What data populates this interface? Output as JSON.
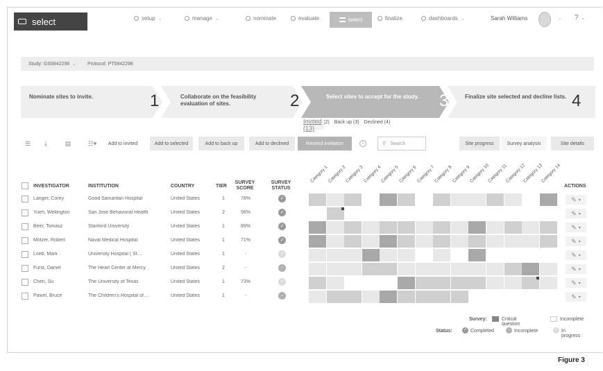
{
  "app": {
    "logo_label": "select"
  },
  "nav": {
    "setup": "setup",
    "manage": "manage",
    "nominate": "nominate",
    "evaluate": "evaluate",
    "select": "select",
    "finalize": "finalize",
    "dashboards": "dashboards",
    "user": "Sarah Williams",
    "help": "?"
  },
  "studybar": {
    "study": "Study: GS5842298",
    "protocol": "Protocol: PT5842298"
  },
  "steps": [
    {
      "text": "Nominate sites to invite.",
      "num": "1"
    },
    {
      "text": "Collaborate on the feasibility evaluation of sites.",
      "num": "2"
    },
    {
      "text": "Select sites to accept for the study.",
      "num": "3"
    },
    {
      "text": "Finalize site selected and decline lists.",
      "num": "4"
    }
  ],
  "subtabs": [
    "Invited (13)",
    "Selected (2)",
    "Back up (3)",
    "Declined (4)"
  ],
  "toolbar": {
    "add_invited": "Add to invited",
    "add_selected": "Add to selected",
    "add_backup": "Add to back up",
    "add_declined": "Add to declined",
    "resend": "Resend invitation",
    "search_placeholder": "Search",
    "site_progress": "Site progress",
    "survey_analysis": "Survey analysis",
    "site_details": "Site details"
  },
  "table": {
    "headers": {
      "investigator": "INVESTIGATOR",
      "institution": "INSTITUTION",
      "country": "COUNTRY",
      "tier": "TIER",
      "survey_score": "SURVEY SCORE",
      "survey_status": "SURVEY STATUS",
      "actions": "ACTIONS"
    },
    "categories": [
      "Category 1",
      "Category 2",
      "Category 3",
      "Category 4",
      "Category 5",
      "Category 6",
      "Category 7",
      "Category 8",
      "Category 9",
      "Category 10",
      "Category 11",
      "Category 12",
      "Category 13",
      "Category 14"
    ],
    "rows": [
      {
        "investigator": "Langer, Corey",
        "institution": "Good Samaritan Hospital",
        "country": "United States",
        "tier": "1",
        "score": "78%",
        "status": "completed",
        "cells": [
          2,
          1,
          2,
          0,
          3,
          2,
          0,
          2,
          1,
          1,
          2,
          1,
          0,
          3
        ],
        "crit": []
      },
      {
        "investigator": "Yueh, Wellington",
        "institution": "San Jose Behavioral Health",
        "country": "United States",
        "tier": "2",
        "score": "56%",
        "status": "completed",
        "cells": [
          0,
          2,
          0,
          0,
          0,
          0,
          0,
          0,
          0,
          0,
          0,
          0,
          0,
          0
        ],
        "crit": [
          1
        ]
      },
      {
        "investigator": "Beer, Tomasz",
        "institution": "Stanford University",
        "country": "United States",
        "tier": "1",
        "score": "89%",
        "status": "completed",
        "cells": [
          3,
          1,
          2,
          1,
          2,
          2,
          1,
          2,
          1,
          3,
          1,
          2,
          1,
          2
        ],
        "crit": []
      },
      {
        "investigator": "Motzer, Robert",
        "institution": "Naval Medical Hospital",
        "country": "United States",
        "tier": "1",
        "score": "71%",
        "status": "completed",
        "cells": [
          3,
          1,
          2,
          1,
          3,
          2,
          1,
          2,
          1,
          2,
          1,
          1,
          1,
          2
        ],
        "crit": []
      },
      {
        "investigator": "Loeb, Mark",
        "institution": "University Hospital ( St…",
        "country": "United States",
        "tier": "1",
        "score": "-",
        "status": "in_progress",
        "cells": [
          1,
          1,
          1,
          3,
          1,
          1,
          0,
          1,
          0,
          3,
          0,
          0,
          0,
          0
        ],
        "crit": []
      },
      {
        "investigator": "Furst, Daniel",
        "institution": "The Heart Center at Mercy",
        "country": "United States",
        "tier": "2",
        "score": "-",
        "status": "incomplete",
        "cells": [
          1,
          1,
          1,
          2,
          2,
          1,
          1,
          1,
          1,
          1,
          1,
          2,
          3,
          1
        ],
        "crit": []
      },
      {
        "investigator": "Chen, Su",
        "institution": "The University of Texas",
        "country": "United States",
        "tier": "1",
        "score": "73%",
        "status": "in_progress",
        "cells": [
          2,
          1,
          0,
          0,
          0,
          3,
          2,
          2,
          2,
          2,
          1,
          1,
          2,
          1
        ],
        "crit": [
          12
        ]
      },
      {
        "investigator": "Pawel, Bruce",
        "institution": "The Children's Hospital of…",
        "country": "United States",
        "tier": "1",
        "score": "-",
        "status": "incomplete",
        "cells": [
          1,
          2,
          2,
          1,
          3,
          2,
          2,
          2,
          2,
          0,
          0,
          0,
          0,
          0
        ],
        "crit": []
      }
    ]
  },
  "legend": {
    "survey": "Survey:",
    "critical": "Critical question",
    "incomplete_label": "Incomplete",
    "status": "Status:",
    "completed": "Completed",
    "incomplete": "Incomplete",
    "in_progress": "In progress"
  },
  "figure_label": "Figure 3",
  "colors": {
    "cell0": "#ffffff",
    "cell1": "#e8e8e8",
    "cell2": "#cfcfcf",
    "cell3": "#a8a8a8",
    "status_completed": "#9a9a9a",
    "status_in_progress": "#dcdcdc",
    "status_incomplete": "#b0b0b0"
  }
}
